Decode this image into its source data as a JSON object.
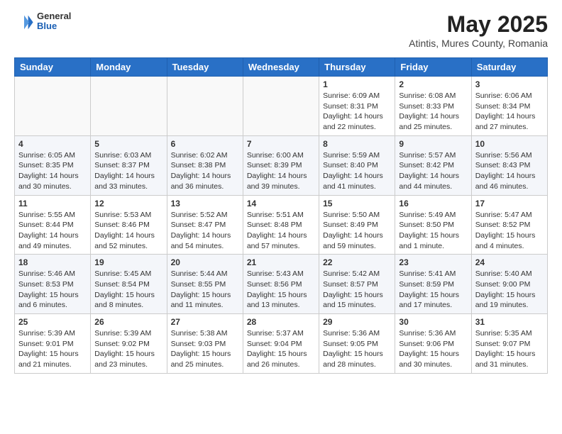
{
  "header": {
    "logo": {
      "general": "General",
      "blue": "Blue"
    },
    "title": "May 2025",
    "subtitle": "Atintis, Mures County, Romania"
  },
  "weekdays": [
    "Sunday",
    "Monday",
    "Tuesday",
    "Wednesday",
    "Thursday",
    "Friday",
    "Saturday"
  ],
  "weeks": [
    [
      {
        "day": "",
        "info": ""
      },
      {
        "day": "",
        "info": ""
      },
      {
        "day": "",
        "info": ""
      },
      {
        "day": "",
        "info": ""
      },
      {
        "day": "1",
        "info": "Sunrise: 6:09 AM\nSunset: 8:31 PM\nDaylight: 14 hours\nand 22 minutes."
      },
      {
        "day": "2",
        "info": "Sunrise: 6:08 AM\nSunset: 8:33 PM\nDaylight: 14 hours\nand 25 minutes."
      },
      {
        "day": "3",
        "info": "Sunrise: 6:06 AM\nSunset: 8:34 PM\nDaylight: 14 hours\nand 27 minutes."
      }
    ],
    [
      {
        "day": "4",
        "info": "Sunrise: 6:05 AM\nSunset: 8:35 PM\nDaylight: 14 hours\nand 30 minutes."
      },
      {
        "day": "5",
        "info": "Sunrise: 6:03 AM\nSunset: 8:37 PM\nDaylight: 14 hours\nand 33 minutes."
      },
      {
        "day": "6",
        "info": "Sunrise: 6:02 AM\nSunset: 8:38 PM\nDaylight: 14 hours\nand 36 minutes."
      },
      {
        "day": "7",
        "info": "Sunrise: 6:00 AM\nSunset: 8:39 PM\nDaylight: 14 hours\nand 39 minutes."
      },
      {
        "day": "8",
        "info": "Sunrise: 5:59 AM\nSunset: 8:40 PM\nDaylight: 14 hours\nand 41 minutes."
      },
      {
        "day": "9",
        "info": "Sunrise: 5:57 AM\nSunset: 8:42 PM\nDaylight: 14 hours\nand 44 minutes."
      },
      {
        "day": "10",
        "info": "Sunrise: 5:56 AM\nSunset: 8:43 PM\nDaylight: 14 hours\nand 46 minutes."
      }
    ],
    [
      {
        "day": "11",
        "info": "Sunrise: 5:55 AM\nSunset: 8:44 PM\nDaylight: 14 hours\nand 49 minutes."
      },
      {
        "day": "12",
        "info": "Sunrise: 5:53 AM\nSunset: 8:46 PM\nDaylight: 14 hours\nand 52 minutes."
      },
      {
        "day": "13",
        "info": "Sunrise: 5:52 AM\nSunset: 8:47 PM\nDaylight: 14 hours\nand 54 minutes."
      },
      {
        "day": "14",
        "info": "Sunrise: 5:51 AM\nSunset: 8:48 PM\nDaylight: 14 hours\nand 57 minutes."
      },
      {
        "day": "15",
        "info": "Sunrise: 5:50 AM\nSunset: 8:49 PM\nDaylight: 14 hours\nand 59 minutes."
      },
      {
        "day": "16",
        "info": "Sunrise: 5:49 AM\nSunset: 8:50 PM\nDaylight: 15 hours\nand 1 minute."
      },
      {
        "day": "17",
        "info": "Sunrise: 5:47 AM\nSunset: 8:52 PM\nDaylight: 15 hours\nand 4 minutes."
      }
    ],
    [
      {
        "day": "18",
        "info": "Sunrise: 5:46 AM\nSunset: 8:53 PM\nDaylight: 15 hours\nand 6 minutes."
      },
      {
        "day": "19",
        "info": "Sunrise: 5:45 AM\nSunset: 8:54 PM\nDaylight: 15 hours\nand 8 minutes."
      },
      {
        "day": "20",
        "info": "Sunrise: 5:44 AM\nSunset: 8:55 PM\nDaylight: 15 hours\nand 11 minutes."
      },
      {
        "day": "21",
        "info": "Sunrise: 5:43 AM\nSunset: 8:56 PM\nDaylight: 15 hours\nand 13 minutes."
      },
      {
        "day": "22",
        "info": "Sunrise: 5:42 AM\nSunset: 8:57 PM\nDaylight: 15 hours\nand 15 minutes."
      },
      {
        "day": "23",
        "info": "Sunrise: 5:41 AM\nSunset: 8:59 PM\nDaylight: 15 hours\nand 17 minutes."
      },
      {
        "day": "24",
        "info": "Sunrise: 5:40 AM\nSunset: 9:00 PM\nDaylight: 15 hours\nand 19 minutes."
      }
    ],
    [
      {
        "day": "25",
        "info": "Sunrise: 5:39 AM\nSunset: 9:01 PM\nDaylight: 15 hours\nand 21 minutes."
      },
      {
        "day": "26",
        "info": "Sunrise: 5:39 AM\nSunset: 9:02 PM\nDaylight: 15 hours\nand 23 minutes."
      },
      {
        "day": "27",
        "info": "Sunrise: 5:38 AM\nSunset: 9:03 PM\nDaylight: 15 hours\nand 25 minutes."
      },
      {
        "day": "28",
        "info": "Sunrise: 5:37 AM\nSunset: 9:04 PM\nDaylight: 15 hours\nand 26 minutes."
      },
      {
        "day": "29",
        "info": "Sunrise: 5:36 AM\nSunset: 9:05 PM\nDaylight: 15 hours\nand 28 minutes."
      },
      {
        "day": "30",
        "info": "Sunrise: 5:36 AM\nSunset: 9:06 PM\nDaylight: 15 hours\nand 30 minutes."
      },
      {
        "day": "31",
        "info": "Sunrise: 5:35 AM\nSunset: 9:07 PM\nDaylight: 15 hours\nand 31 minutes."
      }
    ]
  ]
}
